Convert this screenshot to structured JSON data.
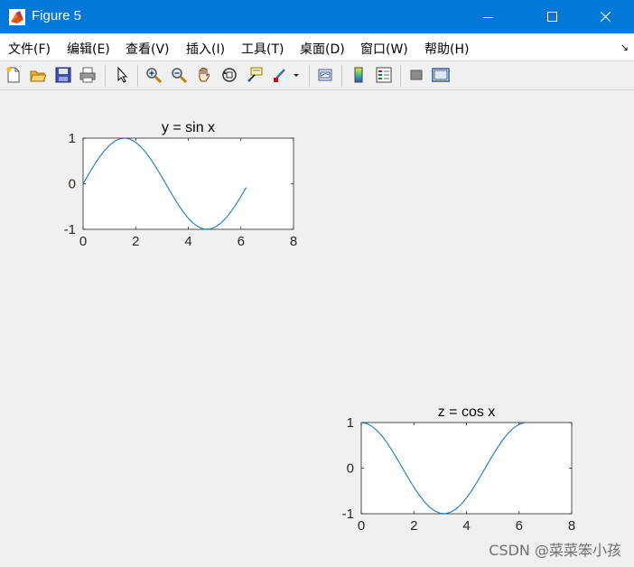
{
  "window": {
    "title": "Figure 5"
  },
  "menu": [
    {
      "label": "文件(F)"
    },
    {
      "label": "编辑(E)"
    },
    {
      "label": "查看(V)"
    },
    {
      "label": "插入(I)"
    },
    {
      "label": "工具(T)"
    },
    {
      "label": "桌面(D)"
    },
    {
      "label": "窗口(W)"
    },
    {
      "label": "帮助(H)"
    }
  ],
  "toolbar": {
    "icons": [
      "new-figure-icon",
      "open-file-icon",
      "save-icon",
      "print-icon",
      "edit-plot-arrow-icon",
      "zoom-in-icon",
      "zoom-out-icon",
      "pan-hand-icon",
      "rotate-3d-icon",
      "data-cursor-icon",
      "brush-icon",
      "brush-dropdown-icon",
      "link-plot-icon",
      "insert-colorbar-icon",
      "insert-legend-icon",
      "hide-plot-tools-icon",
      "show-plot-tools-icon"
    ]
  },
  "watermark": "CSDN @菜菜笨小孩",
  "chart_data": [
    {
      "type": "line",
      "title": "y = sin x",
      "xlim": [
        0,
        8
      ],
      "ylim": [
        -1,
        1
      ],
      "xticks": [
        "0",
        "2",
        "4",
        "6",
        "8"
      ],
      "yticks": [
        "1",
        "0",
        "-1"
      ],
      "series": [
        {
          "x": [
            0,
            0.2,
            0.4,
            0.6,
            0.8,
            1.0,
            1.2,
            1.4,
            1.6,
            1.8,
            2.0,
            2.2,
            2.4,
            2.6,
            2.8,
            3.0,
            3.2,
            3.4,
            3.6,
            3.8,
            4.0,
            4.2,
            4.4,
            4.6,
            4.8,
            5.0,
            5.2,
            5.4,
            5.6,
            5.8,
            6.0,
            6.2
          ],
          "y": [
            0,
            0.199,
            0.389,
            0.565,
            0.717,
            0.841,
            0.932,
            0.985,
            1.0,
            0.974,
            0.909,
            0.808,
            0.675,
            0.516,
            0.335,
            0.141,
            -0.058,
            -0.256,
            -0.443,
            -0.612,
            -0.757,
            -0.872,
            -0.952,
            -0.994,
            -0.996,
            -0.959,
            -0.883,
            -0.773,
            -0.631,
            -0.465,
            -0.279,
            -0.083
          ],
          "color": "#0072bd"
        }
      ]
    },
    {
      "type": "line",
      "title": "z = cos x",
      "xlim": [
        0,
        8
      ],
      "ylim": [
        -1,
        1
      ],
      "xticks": [
        "0",
        "2",
        "4",
        "6",
        "8"
      ],
      "yticks": [
        "1",
        "0",
        "-1"
      ],
      "series": [
        {
          "x": [
            0,
            0.2,
            0.4,
            0.6,
            0.8,
            1.0,
            1.2,
            1.4,
            1.6,
            1.8,
            2.0,
            2.2,
            2.4,
            2.6,
            2.8,
            3.0,
            3.2,
            3.4,
            3.6,
            3.8,
            4.0,
            4.2,
            4.4,
            4.6,
            4.8,
            5.0,
            5.2,
            5.4,
            5.6,
            5.8,
            6.0,
            6.2
          ],
          "y": [
            1,
            0.98,
            0.921,
            0.825,
            0.697,
            0.54,
            0.362,
            0.17,
            -0.029,
            -0.227,
            -0.416,
            -0.589,
            -0.737,
            -0.857,
            -0.942,
            -0.99,
            -0.998,
            -0.967,
            -0.897,
            -0.791,
            -0.654,
            -0.49,
            -0.307,
            -0.112,
            0.087,
            0.284,
            0.469,
            0.635,
            0.776,
            0.886,
            0.96,
            0.997
          ],
          "color": "#0072bd"
        }
      ]
    }
  ]
}
